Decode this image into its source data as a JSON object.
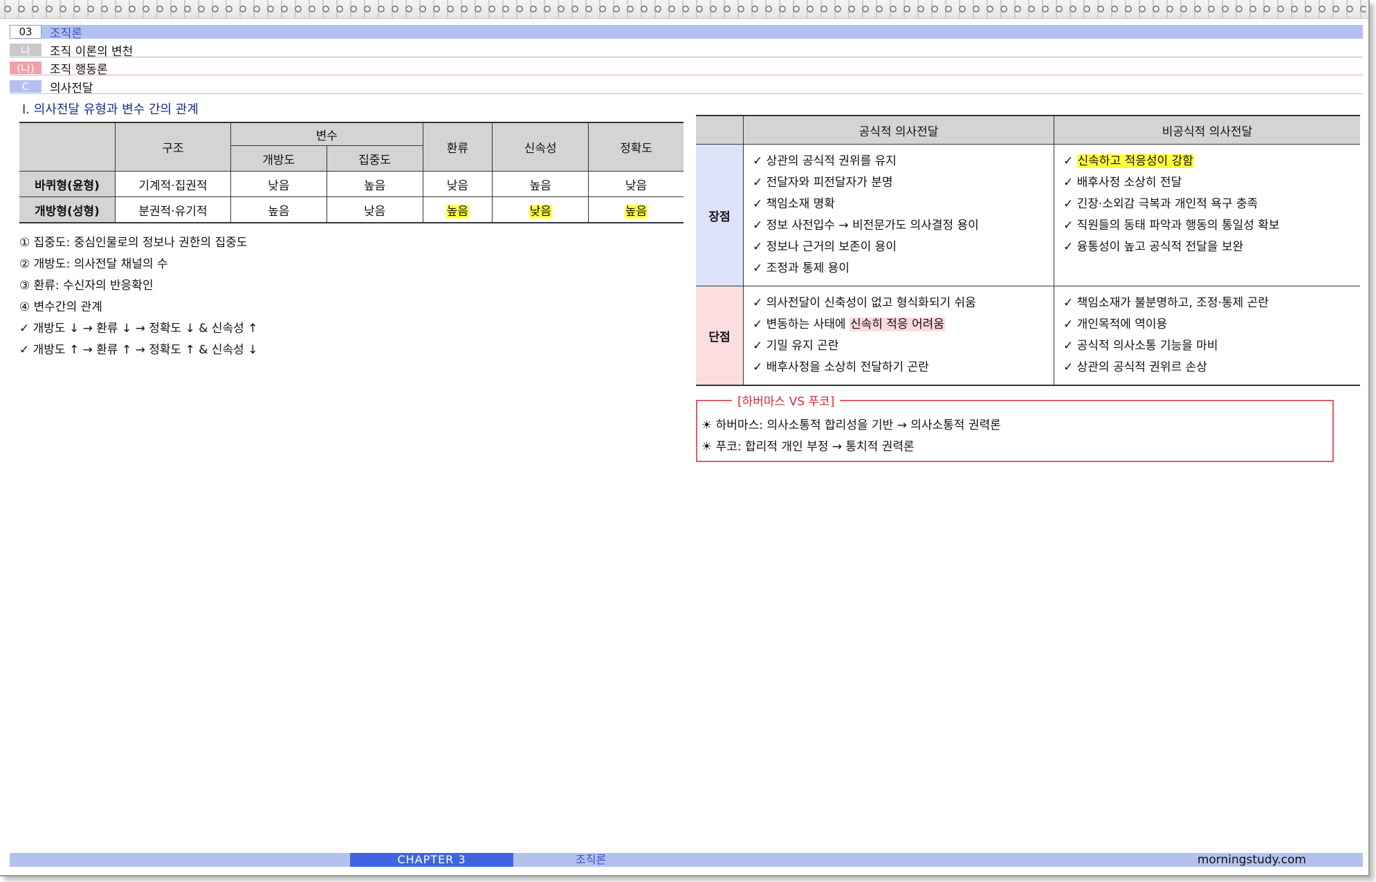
{
  "header": {
    "rows": [
      {
        "tag": "03",
        "text": "조직론"
      },
      {
        "tag": "나",
        "text": "조직 이론의 변천"
      },
      {
        "tag": "(나)",
        "text": "조직 행동론"
      },
      {
        "tag": "C",
        "text": "의사전달"
      }
    ]
  },
  "section_title": "Ⅰ. 의사전달 유형과 변수 간의 관계",
  "left_table": {
    "header": {
      "structure": "구조",
      "variable": "변수",
      "openness": "개방도",
      "centralization": "집중도",
      "feedback": "환류",
      "speed": "신속성",
      "accuracy": "정확도"
    },
    "rows": [
      {
        "type": "바퀴형(윤형)",
        "structure": "기계적·집권적",
        "openness": "낮음",
        "centralization": "높음",
        "feedback": "낮음",
        "speed": "높음",
        "accuracy": "낮음"
      },
      {
        "type": "개방형(성형)",
        "structure": "분권적·유기적",
        "openness": "높음",
        "centralization": "낮음",
        "feedback": "높음",
        "speed": "낮음",
        "accuracy": "높음"
      }
    ]
  },
  "notes": [
    "① 집중도: 중심인물로의 정보나 권한의 집중도",
    "② 개방도: 의사전달 채널의 수",
    "③ 환류: 수신자의 반응확인",
    "④ 변수간의 관계",
    "✓ 개방도 ↓ → 환류 ↓ → 정확도 ↓ & 신속성 ↑",
    "✓ 개방도 ↑ → 환류 ↑ → 정확도 ↑ & 신속성 ↓"
  ],
  "right_table": {
    "col_formal": "공식적 의사전달",
    "col_informal": "비공식적 의사전달",
    "advantages_label": "장점",
    "disadvantages_label": "단점",
    "formal_advantages": [
      "✓ 상관의 공식적 권위를 유지",
      "✓ 전달자와 피전달자가 분명",
      "✓ 책임소재 명확",
      "✓ 정보 사전입수 → 비전문가도 의사결정 용이",
      "✓ 정보나 근거의 보존이 용이",
      "✓ 조정과 통제 용이"
    ],
    "informal_advantages_first_prefix": "✓ ",
    "informal_advantages_first_highlight": "신속하고 적응성이 강함",
    "informal_advantages": [
      "✓ 배후사정 소상히 전달",
      "✓ 긴장·소외감 극복과 개인적 욕구 충족",
      "✓ 직원들의 동태 파악과 행동의 통일성 확보",
      "✓ 융통성이 높고 공식적 전달을 보완"
    ],
    "formal_disadvantages_1": "✓ 의사전달이 신축성이 없고 형식화되기 쉬움",
    "formal_disadvantages_2_prefix": "✓ 변동하는 사태에 ",
    "formal_disadvantages_2_highlight": "신속히 적응 어려움",
    "formal_disadvantages_rest": [
      "✓ 기밀 유지 곤란",
      "✓ 배후사정을 소상히 전달하기 곤란"
    ],
    "informal_disadvantages": [
      "✓ 책임소재가 불분명하고, 조정·통제 곤란",
      "✓ 개인목적에 역이용",
      "✓ 공식적 의사소통 기능을 마비",
      "✓ 상관의 공식적 권위르 손상"
    ]
  },
  "box": {
    "title": "[하버마스 VS 푸코]",
    "lines": [
      "☀ 하버마스: 의사소통적 합리성을 기반 → 의사소통적 권력론",
      "☀ 푸코: 합리적 개인 부정 → 통치적 권력론"
    ]
  },
  "footer": {
    "chapter": "CHAPTER 3",
    "title": "조직론",
    "site": "morningstudy.com"
  },
  "colors": {
    "header_blue": "#b4c1ef",
    "chapter_blue": "#3e66e0",
    "highlight_yellow": "#ffff3b",
    "box_red": "#e05a67"
  }
}
